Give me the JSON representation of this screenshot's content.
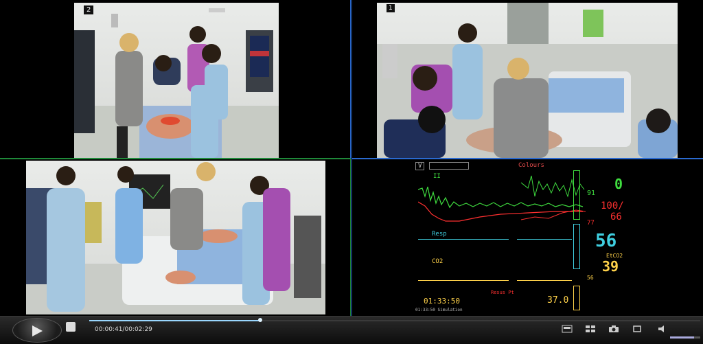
{
  "panes": {
    "cam1": {
      "label": "2"
    },
    "cam2": {
      "label": "1"
    }
  },
  "monitor": {
    "top_small_left": "V",
    "top_title": "Colours",
    "lead_label": "II",
    "resp_label": "Resp",
    "co2_label": "CO2",
    "hr_value": "0",
    "spo2_value": "91",
    "bp_value": "100/",
    "bp_value2": "66",
    "bp_mean": "77",
    "rr_value": "56",
    "etco2_label": "EtCO2",
    "etco2_value": "39",
    "etco2_sub": "56",
    "time_value": "01:33:50",
    "temp_value": "37.0",
    "bottom_left_text": "Resus Pt",
    "bottom_right_text": "01:33:50 Simulation"
  },
  "player": {
    "elapsed": "00:00:41",
    "separator": "/",
    "total": "00:02:29",
    "progress": 0.28,
    "volume": 0.8
  },
  "colors": {
    "green_border": "#1f8a3a",
    "blue_border": "#2a6ad0",
    "ecg": "#3fdc3f",
    "bp": "#ff3030",
    "resp": "#3fcfe0",
    "co2": "#ffd24a"
  },
  "icons": [
    "play-icon",
    "stop-icon",
    "layout-single-icon",
    "layout-quad-icon",
    "snapshot-icon",
    "fullscreen-icon",
    "volume-icon"
  ]
}
